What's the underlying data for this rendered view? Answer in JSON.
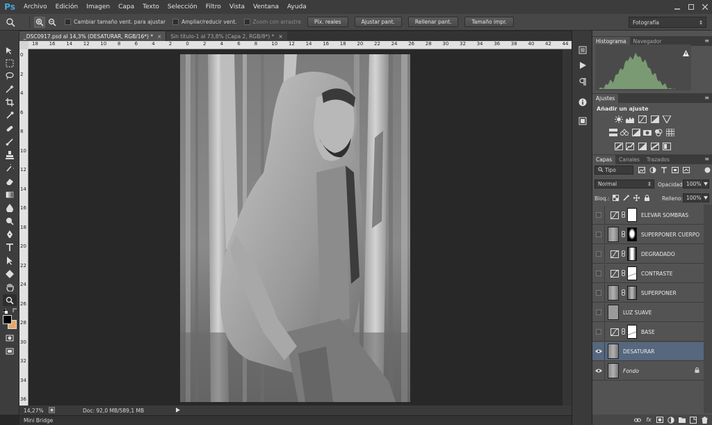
{
  "menubar": {
    "logo": "Ps",
    "items": [
      "Archivo",
      "Edición",
      "Imagen",
      "Capa",
      "Texto",
      "Selección",
      "Filtro",
      "Vista",
      "Ventana",
      "Ayuda"
    ]
  },
  "options": {
    "chk_resize": "Cambiar tamaño vent. para ajustar",
    "chk_zoom_all": "Ampliar/reducir vent.",
    "chk_scrubby": "Zoom con arrastre",
    "btn_actual": "Píx. reales",
    "btn_fit": "Ajustar pant.",
    "btn_fill": "Rellenar pant.",
    "btn_print": "Tamaño impr.",
    "workspace": "Fotografía"
  },
  "tabs": {
    "active": "_DSC0917.psd al 14,3% (DESATURAR, RGB/16*) *",
    "inactive": "Sin título-1 al 73,8% (Capa 2, RGB/8*) *",
    "close": "×"
  },
  "ruler": {
    "top": [
      "18",
      "16",
      "14",
      "12",
      "10",
      "8",
      "6",
      "4",
      "2",
      "0",
      "2",
      "4",
      "6",
      "8",
      "10",
      "12",
      "14",
      "16",
      "18",
      "20",
      "22",
      "24",
      "26",
      "28",
      "30",
      "32",
      "34",
      "36",
      "38",
      "40",
      "42",
      "44"
    ],
    "left": [
      "0",
      "2",
      "4",
      "6",
      "8",
      "10",
      "12",
      "14",
      "16",
      "18",
      "20",
      "22",
      "24",
      "26",
      "28",
      "30",
      "32",
      "34",
      "36"
    ]
  },
  "status": {
    "zoom": "14,27%",
    "doc": "Doc: 92,0 MB/589,1 MB"
  },
  "minibridge": "Mini Bridge",
  "panels": {
    "histo_tab": "Histograma",
    "nav_tab": "Navegador",
    "adj_tab": "Ajustes",
    "adj_title": "Añadir un ajuste",
    "capas_tab": "Capas",
    "canales_tab": "Canales",
    "trazados_tab": "Trazados",
    "filter": "Tipo",
    "blend": "Normal",
    "opacity_label": "Opacidad:",
    "opacity": "100%",
    "lock_label": "Bloq.:",
    "fill_label": "Relleno:",
    "fill": "100%"
  },
  "layers": [
    {
      "name": "ELEVAR SOMBRAS",
      "visible": false,
      "kind": "curves",
      "mask": "white"
    },
    {
      "name": "SUPERPONER CUERPO",
      "visible": false,
      "kind": "image",
      "mask": "figure"
    },
    {
      "name": "DEGRADADO",
      "visible": false,
      "kind": "curves",
      "mask": "gradient"
    },
    {
      "name": "CONTRASTE",
      "visible": false,
      "kind": "curves",
      "mask": "white-mark"
    },
    {
      "name": "SUPERPONER",
      "visible": false,
      "kind": "image",
      "mask": "image"
    },
    {
      "name": "LUZ SUAVE",
      "visible": false,
      "kind": "gray",
      "mask": "none"
    },
    {
      "name": "BASE",
      "visible": false,
      "kind": "curves",
      "mask": "white-mark"
    },
    {
      "name": "DESATURAR",
      "visible": true,
      "kind": "image",
      "mask": "none",
      "selected": true
    },
    {
      "name": "Fondo",
      "visible": true,
      "kind": "image",
      "mask": "none",
      "locked": true
    }
  ],
  "colors": {
    "fg": "#000000",
    "bg": "#e4a76b",
    "selection": "#56677e",
    "histogram": "#7a9a73"
  }
}
